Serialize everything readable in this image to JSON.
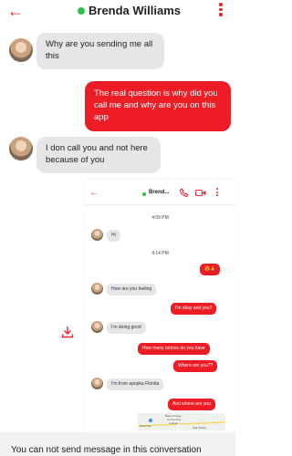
{
  "header": {
    "back_icon": "arrow-left-icon",
    "contact_name": "Brenda Williams",
    "status_color": "#2fbf4a",
    "menu_icon": "kebab-menu-icon"
  },
  "messages": [
    {
      "direction": "in",
      "text": "Why are you sending me all this"
    },
    {
      "direction": "out",
      "text": "The real question is why did you call me and why are you on this app"
    },
    {
      "direction": "in",
      "text": "I don call you and not here because of you"
    }
  ],
  "screenshot": {
    "contact_name": "Brend...",
    "icons": [
      "arrow-left-icon",
      "phone-icon",
      "video-icon",
      "kebab-menu-icon"
    ],
    "time_1": "4:09 PM",
    "time_2": "4:14 PM",
    "msg_hi": "Hi",
    "msg_emoji": "😍🙏",
    "msg_feeling": "How are you feeling",
    "msg_okay": "I'm okay and you?",
    "msg_good": "I'm doing good",
    "msg_tattoos": "How many tattoos do you have",
    "msg_where": "Where are you??",
    "msg_apopka": "I'm from apopka Florida",
    "msg_and_where": "And where are you",
    "map_labels": [
      "Baton Rouge",
      "Community",
      "College",
      "RaceTrac",
      "Dial Pickup"
    ]
  },
  "download_icon": "download-icon",
  "footer": {
    "notice": "You can not send message in this conversation"
  },
  "colors": {
    "accent": "#ee1c25",
    "incoming": "#e6e6e6"
  }
}
